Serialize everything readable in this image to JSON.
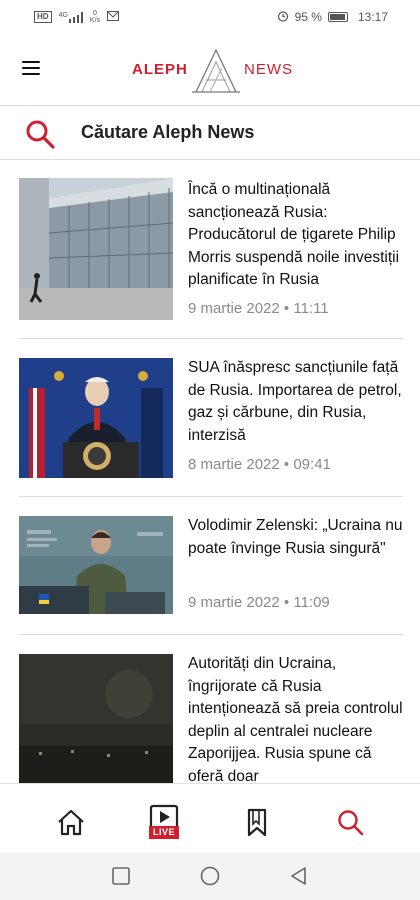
{
  "status_bar": {
    "network_label": "HD",
    "signal_label": "4G",
    "speed_value": "0",
    "speed_unit": "K/s",
    "battery_percent": "95 %",
    "battery_level": 0.95,
    "time": "13:17"
  },
  "header": {
    "logo_left": "ALEPH",
    "logo_right": "NEWS",
    "brand_color": "#d01f2f"
  },
  "search": {
    "label": "Căutare Aleph News"
  },
  "articles": [
    {
      "title": "Încă o multinațională sancționează Rusia: Producătorul de țigarete Philip Morris suspendă noile investiții planificate în Rusia",
      "date": "9 martie 2022",
      "time": "11:11"
    },
    {
      "title": "SUA înăspresc sancțiunile față de Rusia. Importarea de petrol, gaz și cărbune, din Rusia, interzisă",
      "date": "8 martie 2022",
      "time": "09:41"
    },
    {
      "title": "Volodimir Zelenski: „Ucraina nu poate învinge Rusia singură\"",
      "date": "9 martie 2022",
      "time": "11:09"
    },
    {
      "title": "Autorități din Ucraina, îngrijorate că Rusia intenționează să preia controlul deplin al centralei nucleare Zaporijjea. Rusia spune că oferă doar",
      "date": "",
      "time": ""
    }
  ],
  "meta_separator": "•",
  "bottom_nav": {
    "live_label": "LIVE",
    "items": [
      "home-icon",
      "live-icon",
      "bookmark-icon",
      "search-icon"
    ],
    "active_color": "#d01f2f"
  }
}
